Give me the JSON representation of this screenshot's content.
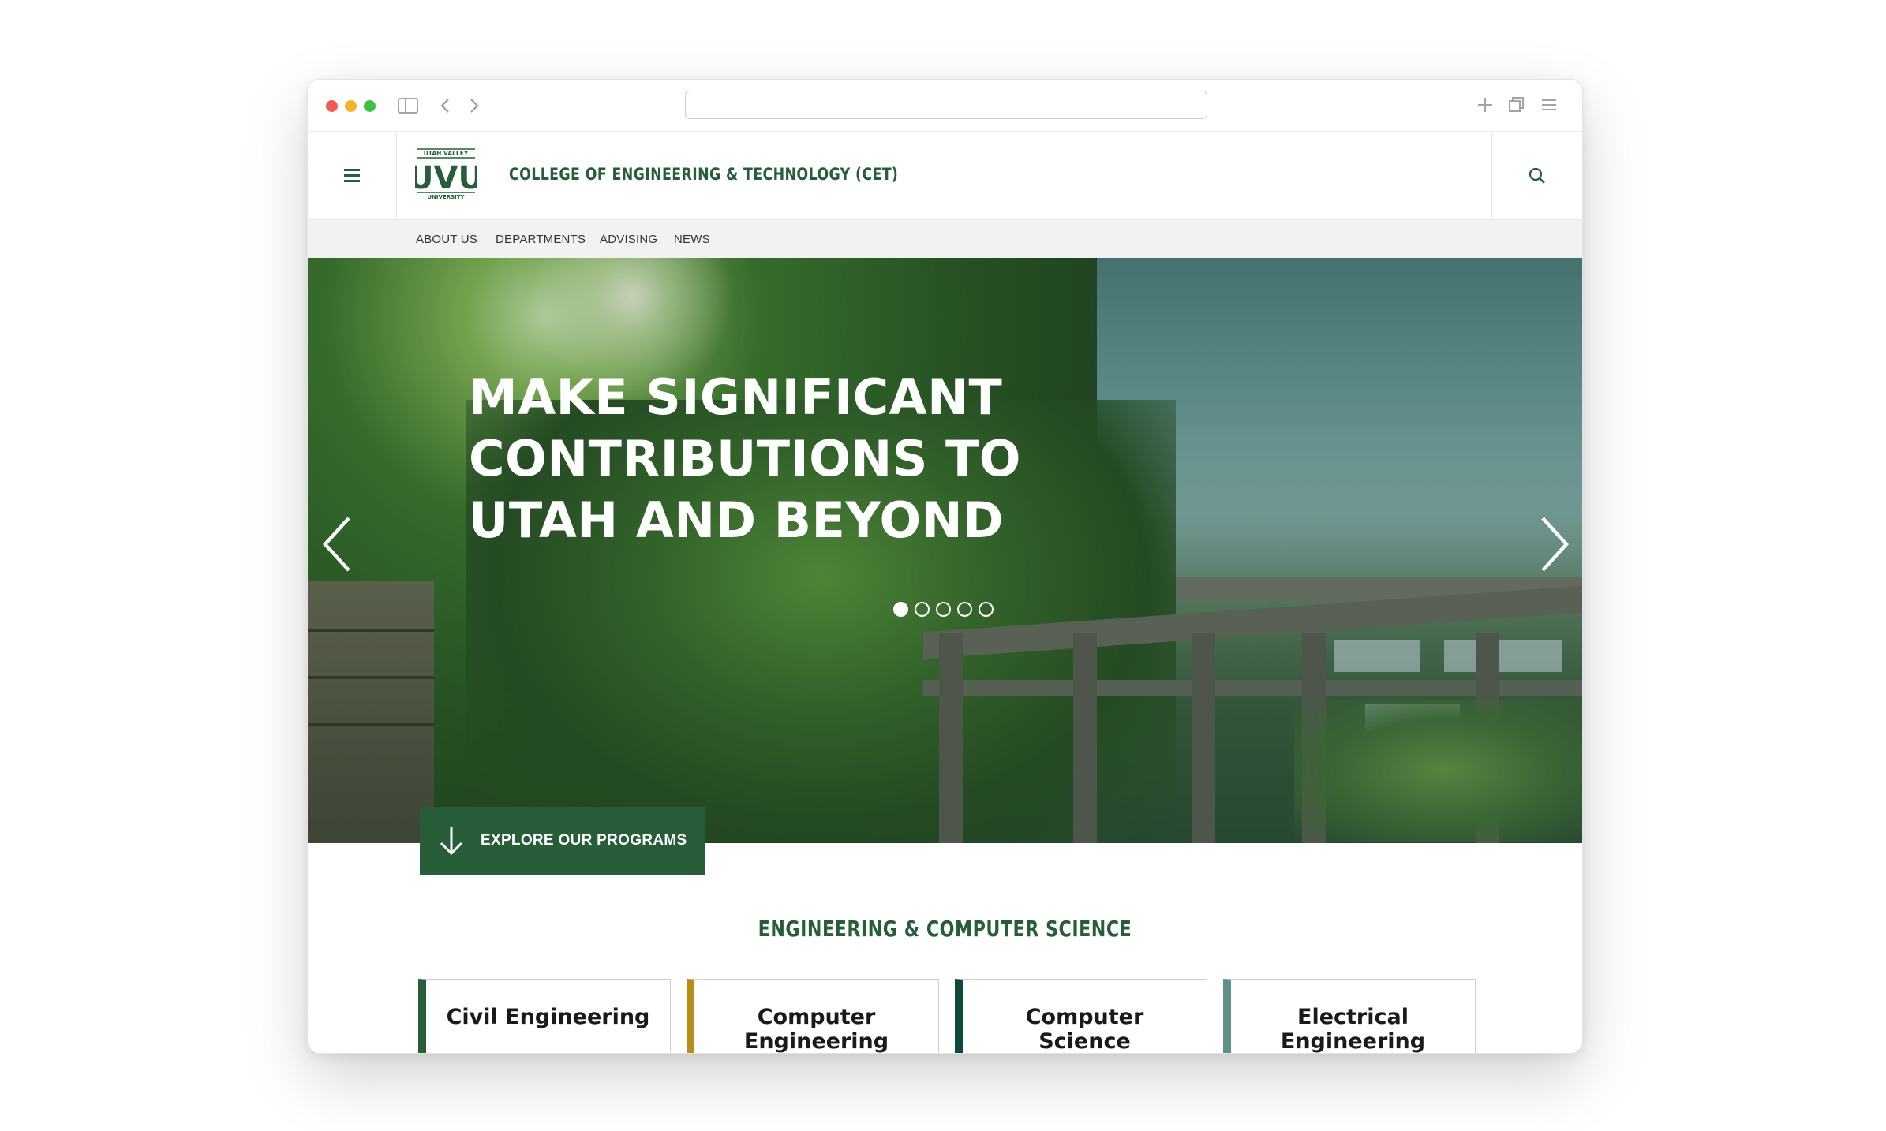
{
  "browser": {
    "address": "",
    "icons": [
      "sidebar-toggle-icon",
      "back-icon",
      "forward-icon",
      "plus-icon",
      "tabs-icon",
      "menu-icon"
    ]
  },
  "header": {
    "logo": {
      "top": "UTAH VALLEY",
      "main": "UVU",
      "bottom": "UNIVERSITY"
    },
    "title": "COLLEGE OF ENGINEERING & TECHNOLOGY (CET)"
  },
  "subnav": {
    "items": [
      "ABOUT US",
      "DEPARTMENTS",
      "ADVISING",
      "NEWS"
    ]
  },
  "hero": {
    "headline": [
      "MAKE SIGNIFICANT",
      "CONTRIBUTIONS TO",
      "UTAH AND BEYOND"
    ],
    "slides_total": 5,
    "active_slide": 1
  },
  "cta": {
    "label": "EXPLORE OUR PROGRAMS"
  },
  "section": {
    "title": "ENGINEERING & COMPUTER SCIENCE",
    "cards": [
      {
        "label": "Civil Engineering",
        "accent": "#275d38"
      },
      {
        "label": "Computer Engineering",
        "accent": "#ba8c1a"
      },
      {
        "label": "Computer Science",
        "accent": "#0c4b3c"
      },
      {
        "label": "Electrical Engineering",
        "accent": "#5e9288"
      }
    ]
  },
  "colors": {
    "brand": "#275d38"
  }
}
